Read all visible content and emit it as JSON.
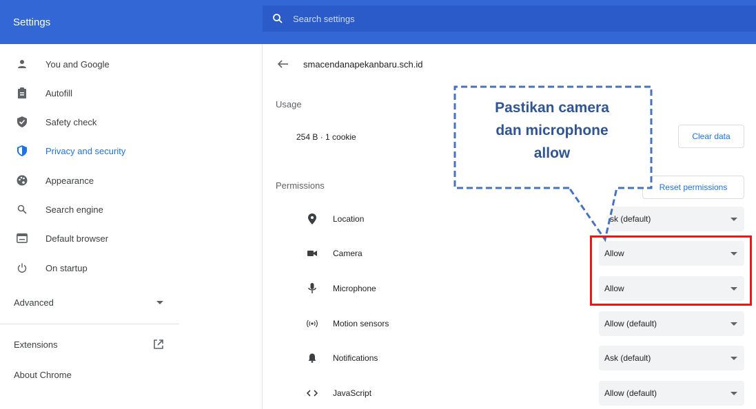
{
  "header": {
    "title": "Settings",
    "search_placeholder": "Search settings"
  },
  "sidebar": {
    "items": [
      {
        "label": "You and Google",
        "icon": "person-icon"
      },
      {
        "label": "Autofill",
        "icon": "clipboard-icon"
      },
      {
        "label": "Safety check",
        "icon": "shield-check-icon"
      },
      {
        "label": "Privacy and security",
        "icon": "shield-icon",
        "active": true
      },
      {
        "label": "Appearance",
        "icon": "palette-icon"
      },
      {
        "label": "Search engine",
        "icon": "search-icon"
      },
      {
        "label": "Default browser",
        "icon": "browser-icon"
      },
      {
        "label": "On startup",
        "icon": "power-icon"
      }
    ],
    "advanced_label": "Advanced",
    "extensions_label": "Extensions",
    "about_label": "About Chrome"
  },
  "site": {
    "domain": "smacendanapekanbaru.sch.id",
    "usage_label": "Usage",
    "usage_value": "254 B · 1 cookie",
    "clear_data_label": "Clear data",
    "permissions_label": "Permissions",
    "reset_permissions_label": "Reset permissions",
    "permissions": [
      {
        "name": "Location",
        "value": "Ask (default)",
        "icon": "location-pin-icon"
      },
      {
        "name": "Camera",
        "value": "Allow",
        "icon": "camera-icon"
      },
      {
        "name": "Microphone",
        "value": "Allow",
        "icon": "microphone-icon"
      },
      {
        "name": "Motion sensors",
        "value": "Allow (default)",
        "icon": "motion-sensors-icon"
      },
      {
        "name": "Notifications",
        "value": "Ask (default)",
        "icon": "bell-icon"
      },
      {
        "name": "JavaScript",
        "value": "Allow (default)",
        "icon": "code-icon"
      }
    ]
  },
  "annotation": {
    "line1": "Pastikan camera",
    "line2": "dan microphone",
    "line3": "allow",
    "text_color": "#2e5597",
    "highlight_color": "#e01b1b"
  },
  "colors": {
    "header_bg": "#3367d6",
    "accent": "#1a73e8"
  }
}
